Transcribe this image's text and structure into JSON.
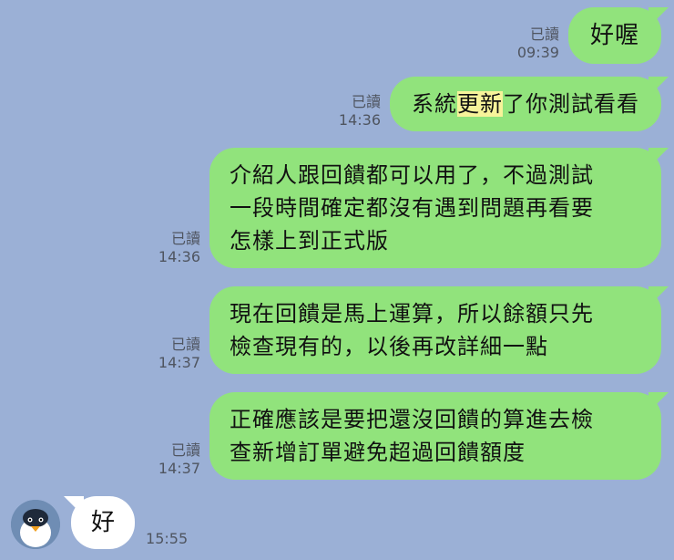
{
  "messages": [
    {
      "read": "已讀",
      "time": "09:39",
      "text": "好喔"
    },
    {
      "read": "已讀",
      "time": "14:36",
      "text_before": "系統",
      "text_highlight": "更新",
      "text_after": "了你測試看看"
    },
    {
      "read": "已讀",
      "time": "14:36",
      "lines": [
        "介紹人跟回饋都可以用了，不過測試",
        "一段時間確定都沒有遇到問題再看要",
        "怎樣上到正式版"
      ]
    },
    {
      "read": "已讀",
      "time": "14:37",
      "lines": [
        "現在回饋是馬上運算，所以餘額只先",
        "檢查現有的，以後再改詳細一點"
      ]
    },
    {
      "read": "已讀",
      "time": "14:37",
      "lines": [
        "正確應該是要把還沒回饋的算進去檢",
        "查新增訂單避免超過回饋額度"
      ]
    }
  ],
  "incoming": {
    "avatar_icon": "penguin-avatar-icon",
    "text": "好",
    "time": "15:55"
  }
}
